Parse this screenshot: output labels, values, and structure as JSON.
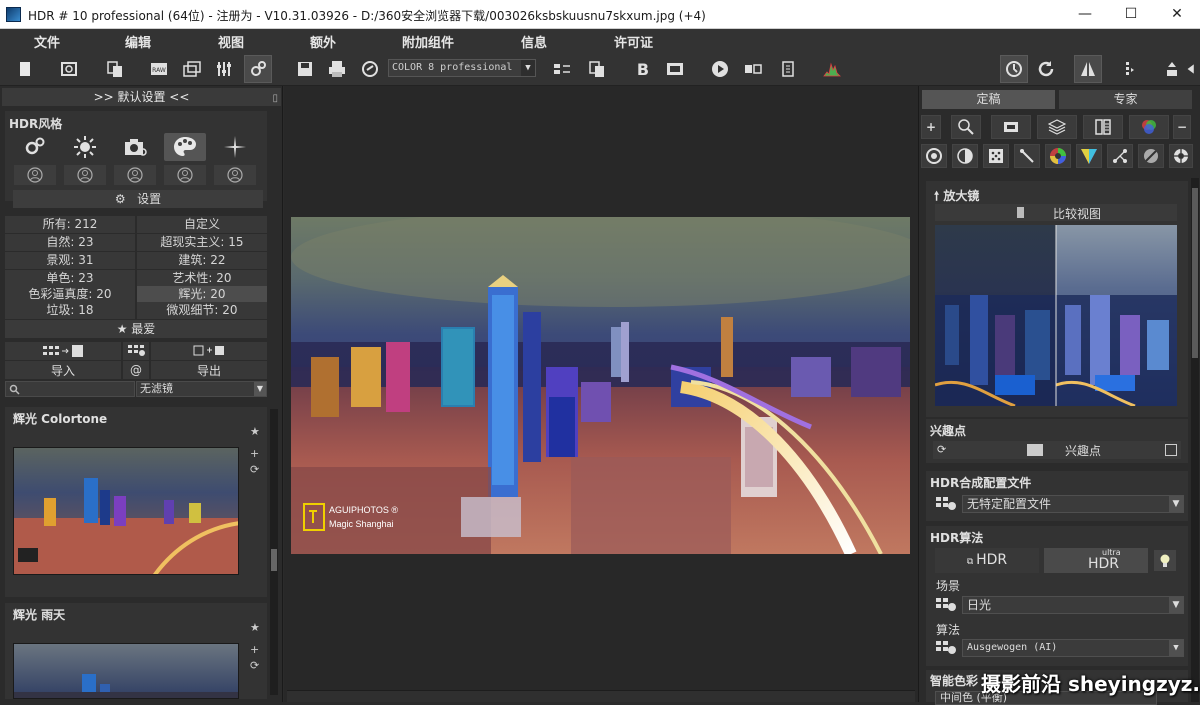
{
  "window": {
    "title": "HDR # 10 professional (64位) - 注册为 - V10.31.03926 - D:/360安全浏览器下载/003026ksbskuusnu7skxum.jpg (+4)",
    "minimize": "—",
    "maximize": "☐",
    "close": "✕"
  },
  "menu": {
    "file": "文件",
    "edit": "编辑",
    "view": "视图",
    "extra": "额外",
    "addons": "附加组件",
    "info": "信息",
    "license": "许可证"
  },
  "toolbar": {
    "color_profile": "COLOR 8 professional",
    "dropdown_arrow": "▼"
  },
  "left_panel": {
    "header": ">> 默认设置 <<",
    "pin": "▯",
    "hdr_style_label": "HDR风格",
    "settings_label": "设置",
    "settings_icon": "⚙",
    "categories": [
      {
        "label": "所有: 212",
        "selected": false
      },
      {
        "label": "自定义",
        "selected": false
      },
      {
        "label": "自然: 23",
        "selected": false
      },
      {
        "label": "超现实主义: 15",
        "selected": false
      },
      {
        "label": "景观: 31",
        "selected": false
      },
      {
        "label": "建筑: 22",
        "selected": false
      },
      {
        "label": "单色: 23",
        "selected": false
      },
      {
        "label": "艺术性: 20",
        "selected": false
      },
      {
        "label": "色彩逼真度: 20",
        "selected": false
      },
      {
        "label": "辉光: 20",
        "selected": true
      },
      {
        "label": "垃圾: 18",
        "selected": false
      },
      {
        "label": "微观细节: 20",
        "selected": false
      }
    ],
    "favorites": "★ 最爱",
    "import_label": "导入",
    "at_label": "@",
    "export_label": "导出",
    "filter": "无滤镜",
    "presets": [
      {
        "title": "辉光 Colortone"
      },
      {
        "title": "辉光 雨天"
      }
    ],
    "preset_star": "★",
    "preset_plus": "+",
    "preset_refresh": "⟳"
  },
  "right_panel": {
    "tabs": [
      "定稿",
      "专家"
    ],
    "plus": "+",
    "minus": "−",
    "magnifier_title": "🠕 放大镜",
    "compare_label": "比较视图",
    "interest_title": "兴趣点",
    "interest_label": "兴趣点",
    "merge_title": "HDR合成配置文件",
    "merge_value": "无特定配置文件",
    "algorithm_title": "HDR算法",
    "hdr_button": "HDR",
    "ultra_small": "ultra",
    "ultra_hdr": "HDR",
    "scene_label": "场景",
    "scene_value": "日光",
    "method_label": "算法",
    "method_value": "Ausgewogen (AI)",
    "smart_color_title": "智能色彩",
    "smart_color_value": "中间色 (平衡)"
  },
  "image": {
    "caption_line1": "AGUIPHOTOS ®",
    "caption_line2": "Magic  Shanghai"
  },
  "watermark": "摄影前沿 sheyingzyz.com"
}
